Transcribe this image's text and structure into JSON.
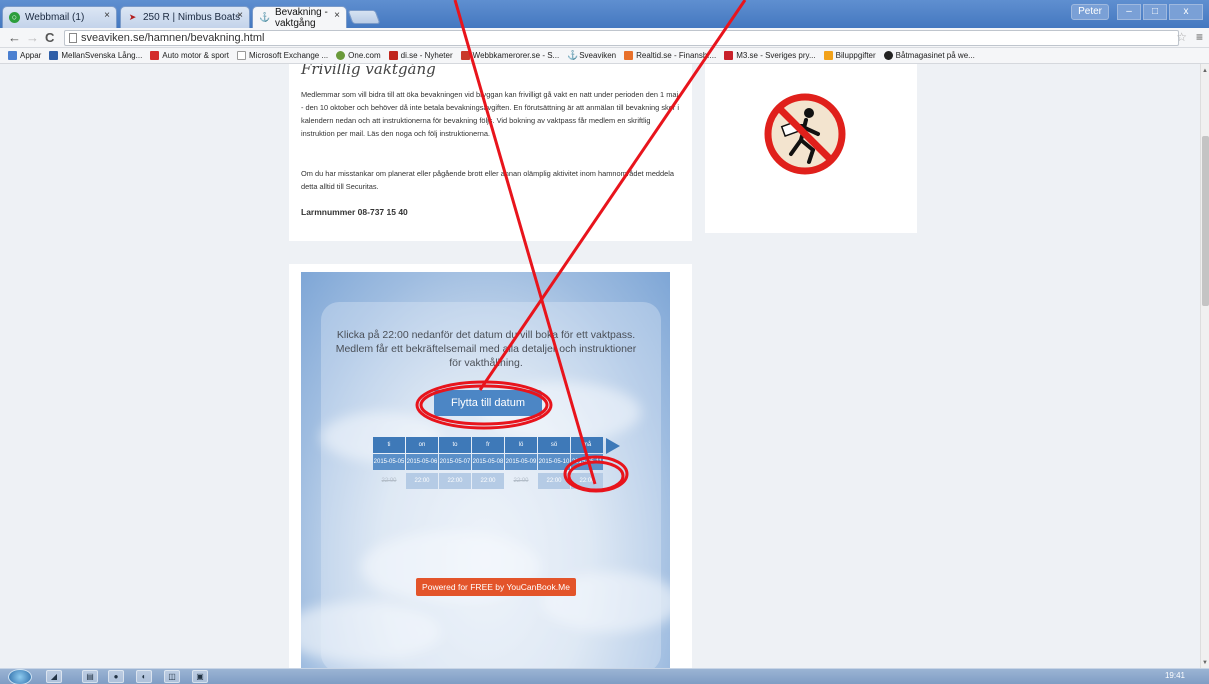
{
  "browser": {
    "tabs": [
      {
        "label": "Webbmail (1)",
        "icon": "webmail-icon"
      },
      {
        "label": "250 R | Nimbus Boats",
        "icon": "nimbus-icon"
      },
      {
        "label": "Bevakning - vaktgång",
        "icon": "anchor-icon"
      }
    ],
    "user": "Peter",
    "url": "sveaviken.se/hamnen/bevakning.html",
    "bookmarks": [
      "Appar",
      "MellanSvenska Lång...",
      "Auto motor & sport",
      "Microsoft Exchange ...",
      "One.com",
      "di.se - Nyheter",
      "Webbkamerorer.se - S...",
      "Sveaviken",
      "Realtid.se - Finansbr...",
      "M3.se - Sveriges pry...",
      "Biluppgifter",
      "Båtmagasinet på we..."
    ]
  },
  "article": {
    "heading": "Frivillig vaktgång",
    "para1": "Medlemmar som vill bidra till att öka bevakningen vid bryggan kan frivilligt gå vakt en natt under perioden den 1 maj - den 10 oktober och behöver då inte betala bevakningsavgiften. En förutsättning är att anmälan till bevakning sker i kalendern nedan och att instruktionerna för bevakning följs. Vid bokning av vaktpass får medlem en skriftlig instruktion per mail. Läs den noga och följ instruktionerna.",
    "para2": "Om du har misstankar om planerat eller pågående brott eller annan olämplig aktivitet inom hamnområdet meddela detta alltid till Securitas.",
    "alarm": "Larmnummer 08-737 15 40"
  },
  "booking": {
    "intro": "Klicka på 22:00 nedanför det datum du vill boka för ett vaktpass. Medlem får ett bekräftelsemail med alla detaljer och instruktioner för vakthållning.",
    "move_button": "Flytta till datum",
    "days": [
      {
        "day": "ti",
        "date": "2015-05-05",
        "slot": "22:00",
        "available": false
      },
      {
        "day": "on",
        "date": "2015-05-06",
        "slot": "22:00",
        "available": true
      },
      {
        "day": "to",
        "date": "2015-05-07",
        "slot": "22:00",
        "available": true
      },
      {
        "day": "fr",
        "date": "2015-05-08",
        "slot": "22:00",
        "available": true
      },
      {
        "day": "lö",
        "date": "2015-05-09",
        "slot": "22:00",
        "available": false
      },
      {
        "day": "sö",
        "date": "2015-05-10",
        "slot": "22:00",
        "available": true
      },
      {
        "day": "må",
        "date": "2015-05-11",
        "slot": "22:00",
        "available": true
      }
    ],
    "powered": "Powered for FREE by YouCanBook.Me"
  },
  "taskbar": {
    "clock": "19:41"
  },
  "colors": {
    "annotation": "#e8141c",
    "accent": "#4c86c5",
    "powered_bg": "#e3542a"
  }
}
